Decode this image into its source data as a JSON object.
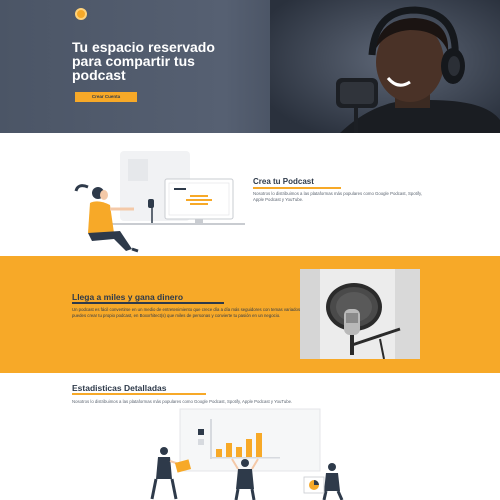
{
  "hero": {
    "logo_icon": "microphone-logo-icon",
    "title": "Tu espacio reservado para compartir tus podcast",
    "button_label": "Crear Cuenta"
  },
  "create": {
    "title": "Crea tu Podcast",
    "description": "Nosotros lo distribuimos a las plataformas más populares como Google Podcast, Spotify, Apple Podcast y YouTube."
  },
  "reach": {
    "title": "Llega a miles y gana dinero",
    "description": "Un podcast es fácil convertirse en un medio de entretenimiento que crece día a día más seguidores con temas variados puedes crear tu propio podcast, en Boxxrhitect(s) que miles de personas y convierte tu pasión en un negocio."
  },
  "stats": {
    "title": "Estadisticas Detalladas",
    "description": "Nosotros lo distribuimos a las plataformas más populares como Google Podcast, Spotify, Apple Podcast y YouTube."
  },
  "colors": {
    "accent": "#f7a928",
    "dark": "#2e3a4a",
    "hero_bg": "#4b5566"
  }
}
